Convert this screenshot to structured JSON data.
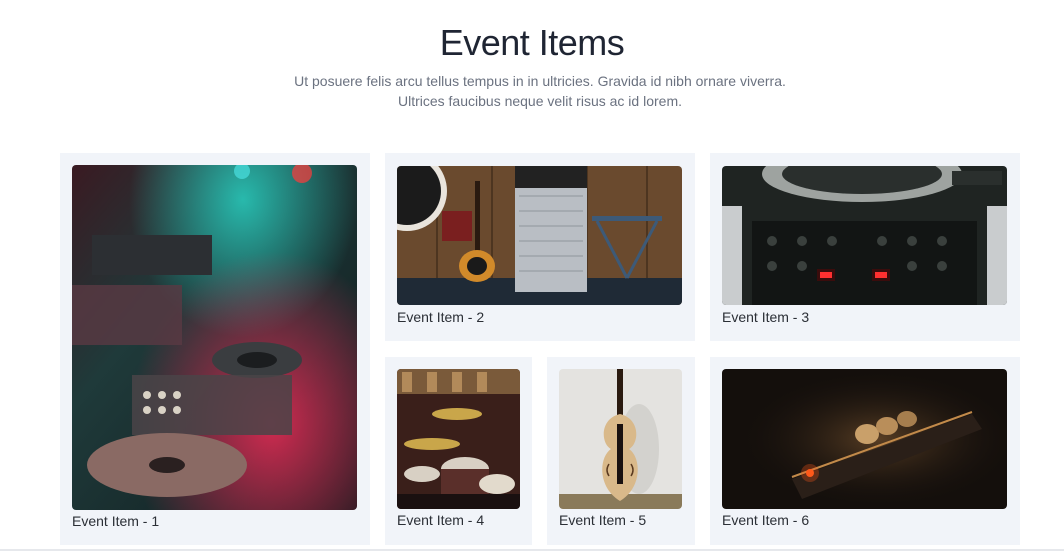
{
  "header": {
    "title": "Event Items",
    "subtitle": "Ut posuere felis arcu tellus tempus in in ultricies. Gravida id nibh ornare viverra. Ultrices faucibus neque velit risus ac id lorem."
  },
  "items": [
    {
      "label": "Event Item - 1",
      "image": "dj-turntable-mixer"
    },
    {
      "label": "Event Item - 2",
      "image": "guitar-amplifier-stage"
    },
    {
      "label": "Event Item - 3",
      "image": "turntable-mixer-closeup"
    },
    {
      "label": "Event Item - 4",
      "image": "drum-kit"
    },
    {
      "label": "Event Item - 5",
      "image": "violin"
    },
    {
      "label": "Event Item - 6",
      "image": "amplifier-knobs"
    }
  ],
  "colors": {
    "card_background": "#f1f4f9",
    "title": "#1f2533",
    "subtitle": "#6b7280"
  }
}
